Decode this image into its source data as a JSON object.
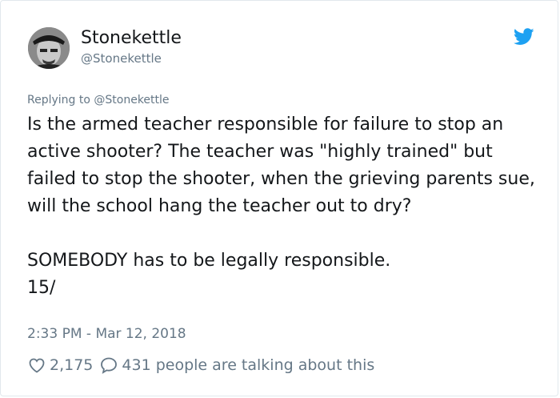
{
  "tweet": {
    "display_name": "Stonekettle",
    "handle": "@Stonekettle",
    "replying_label": "Replying to",
    "replying_to": "@Stonekettle",
    "text": "Is the armed teacher responsible for failure to stop an active shooter? The teacher was \"highly trained\" but failed to stop the shooter, when the grieving parents sue, will the school hang the teacher out to dry?\n\nSOMEBODY has to be legally responsible.\n15/",
    "timestamp": "2:33 PM - Mar 12, 2018",
    "likes": "2,175",
    "talking": "431 people are talking about this"
  },
  "icons": {
    "brand": "twitter-bird-icon",
    "like": "heart-icon",
    "comment": "speech-bubble-icon"
  },
  "colors": {
    "brand": "#1da1f2",
    "secondary_text": "#657786",
    "primary_text": "#14171a",
    "border": "#e1e8ed"
  }
}
